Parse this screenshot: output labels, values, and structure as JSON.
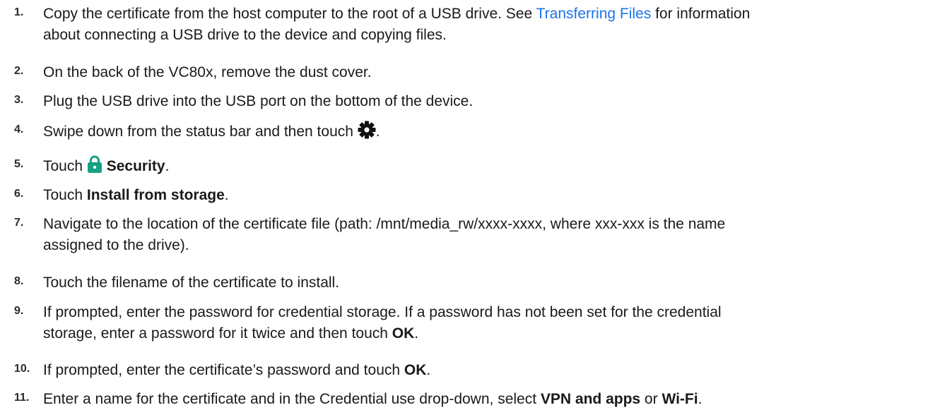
{
  "steps": [
    {
      "num": "1.",
      "line1_pre": "Copy the certificate from the host computer to the root of a USB drive. See ",
      "link": "Transferring Files",
      "line1_post": " for information",
      "line2": "about connecting a USB drive to the device and copying files."
    },
    {
      "num": "2.",
      "text": "On the back of the VC80x, remove the dust cover."
    },
    {
      "num": "3.",
      "text": "Plug the USB drive into the USB port on the bottom of the device."
    },
    {
      "num": "4.",
      "pre": "Swipe down from the status bar and then touch ",
      "icon": "gear-icon",
      "post": "."
    },
    {
      "num": "5.",
      "pre": "Touch ",
      "icon": "lock-icon",
      "bold": "Security",
      "post": "."
    },
    {
      "num": "6.",
      "pre": "Touch ",
      "bold": "Install from storage",
      "post": "."
    },
    {
      "num": "7.",
      "line1": "Navigate to the location of the certificate file (path: /mnt/media_rw/xxxx-xxxx, where xxx-xxx is the name",
      "line2": "assigned to the drive)."
    },
    {
      "num": "8.",
      "text": "Touch the filename of the certificate to install."
    },
    {
      "num": "9.",
      "line1": "If prompted, enter the password for credential storage. If a password has not been set for the credential",
      "line2_pre": "storage, enter a password for it twice and then touch ",
      "bold": "OK",
      "post": "."
    },
    {
      "num": "10.",
      "pre": "If prompted, enter the certificate’s password and touch ",
      "bold": "OK",
      "post": "."
    },
    {
      "num": "11.",
      "pre": "Enter a name for the certificate and in the Credential use drop-down, select ",
      "bold1": "VPN and apps",
      "mid": " or ",
      "bold2": "Wi-Fi",
      "post": "."
    }
  ],
  "colors": {
    "link": "#1a73e8",
    "lock_icon": "#16a085",
    "gear_icon": "#111111"
  }
}
